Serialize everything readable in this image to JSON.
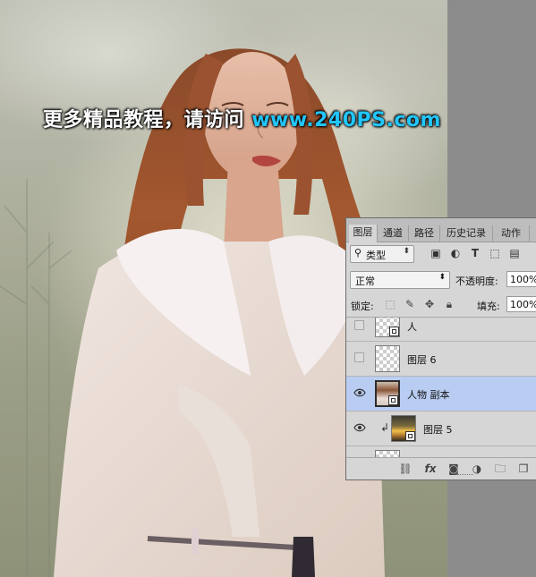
{
  "watermark": {
    "cn_text": "更多精品教程，请访问",
    "url": "www.240PS.com"
  },
  "panel": {
    "tabs": [
      "图层",
      "通道",
      "路径",
      "历史记录",
      "动作"
    ],
    "active_tab": "图层",
    "filter": {
      "kind_label": "类型"
    },
    "blend_mode": "正常",
    "opacity_label": "不透明度:",
    "opacity_value": "100%",
    "lock_label": "锁定:",
    "fill_label": "填充:",
    "fill_value": "100%",
    "layers": [
      {
        "name": "人",
        "visible": false,
        "thumb": "transparent",
        "smart": true
      },
      {
        "name": "图层 6",
        "visible": false,
        "thumb": "transparent",
        "smart": false
      },
      {
        "name": "人物 副本",
        "visible": true,
        "thumb": "portrait",
        "smart": true,
        "selected": true
      },
      {
        "name": "图层 5",
        "visible": true,
        "thumb": "sunset",
        "smart": true,
        "clipped": true
      }
    ]
  },
  "colors": {
    "selected_row": "#b9cdf2",
    "watermark_url": "#21c6ff"
  }
}
